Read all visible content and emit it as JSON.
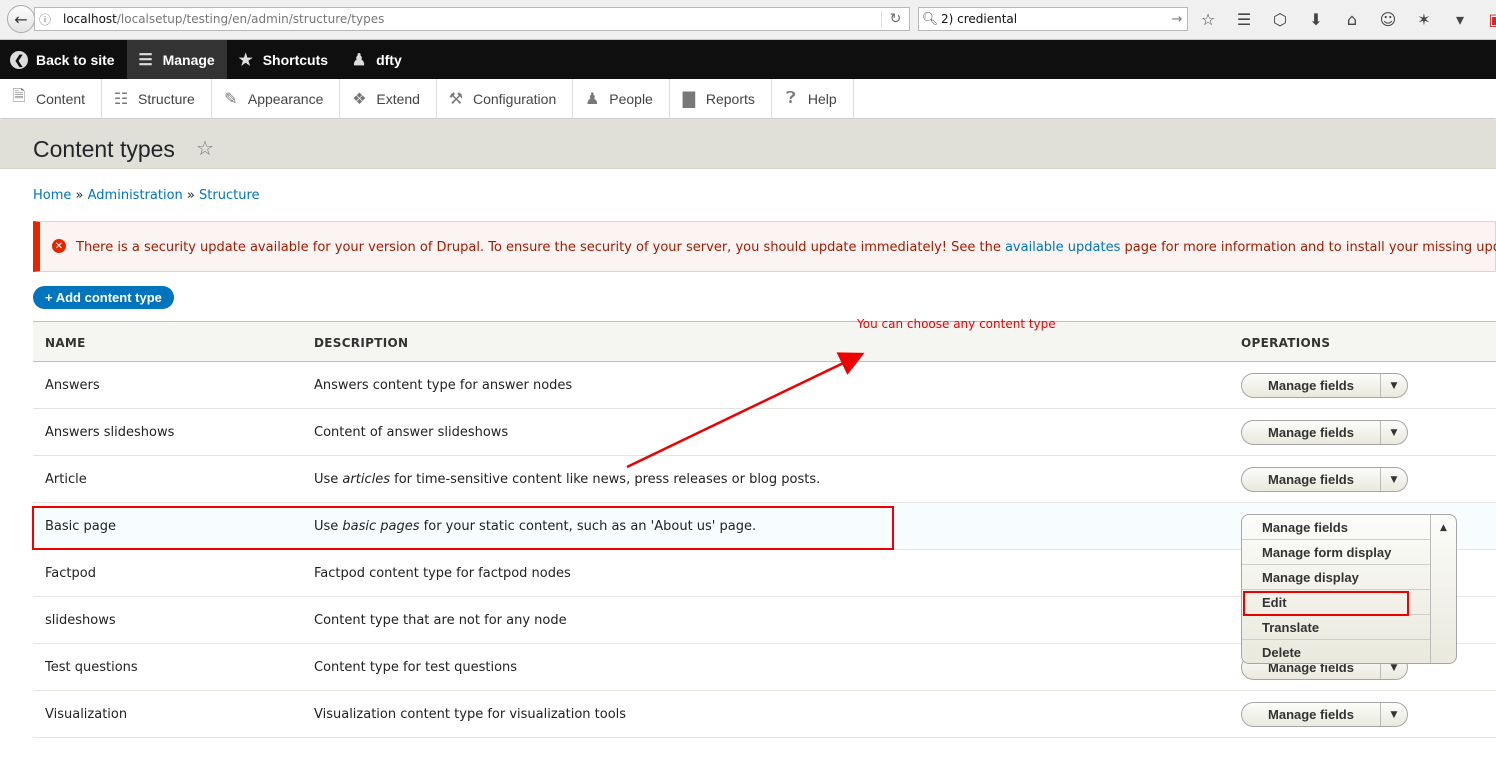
{
  "browser": {
    "url_host": "localhost",
    "url_path": "/localsetup/testing/en/admin/structure/types",
    "search_text": "2) crediental"
  },
  "toolbar": {
    "back_label": "Back to site",
    "manage_label": "Manage",
    "shortcuts_label": "Shortcuts",
    "user_label": "dfty"
  },
  "tray": {
    "items": [
      {
        "label": "Content",
        "icon": "file-icon"
      },
      {
        "label": "Structure",
        "icon": "sitemap-icon"
      },
      {
        "label": "Appearance",
        "icon": "brush-icon"
      },
      {
        "label": "Extend",
        "icon": "puzzle-icon"
      },
      {
        "label": "Configuration",
        "icon": "wrench-icon"
      },
      {
        "label": "People",
        "icon": "user-icon"
      },
      {
        "label": "Reports",
        "icon": "bar-chart-icon"
      },
      {
        "label": "Help",
        "icon": "help-icon"
      }
    ]
  },
  "page": {
    "title": "Content types"
  },
  "breadcrumb": {
    "home": "Home",
    "sep": "»",
    "admin": "Administration",
    "structure": "Structure"
  },
  "alert": {
    "text_before": "There is a security update available for your version of Drupal. To ensure the security of your server, you should update immediately! See the ",
    "link": "available updates",
    "text_after": " page for more information and to install your missing updates."
  },
  "actions": {
    "add_label": "+ Add content type"
  },
  "table": {
    "headers": {
      "name": "NAME",
      "description": "DESCRIPTION",
      "operations": "OPERATIONS"
    },
    "rows": [
      {
        "name": "Answers",
        "desc_pre": "Answers content type for answer nodes",
        "desc_em": "",
        "desc_post": "",
        "op": "Manage fields"
      },
      {
        "name": "Answers slideshows",
        "desc_pre": "Content of answer slideshows",
        "desc_em": "",
        "desc_post": "",
        "op": "Manage fields"
      },
      {
        "name": "Article",
        "desc_pre": "Use ",
        "desc_em": "articles",
        "desc_post": " for time-sensitive content like news, press releases or blog posts.",
        "op": "Manage fields"
      },
      {
        "name": "Basic page",
        "desc_pre": "Use ",
        "desc_em": "basic pages",
        "desc_post": " for your static content, such as an 'About us' page.",
        "op": "Manage fields"
      },
      {
        "name": "Factpod",
        "desc_pre": "Factpod content type for factpod nodes",
        "desc_em": "",
        "desc_post": "",
        "op": ""
      },
      {
        "name": "slideshows",
        "desc_pre": "Content type that are not for any node",
        "desc_em": "",
        "desc_post": "",
        "op": ""
      },
      {
        "name": "Test questions",
        "desc_pre": "Content type for test questions",
        "desc_em": "",
        "desc_post": "",
        "op": "Manage fields"
      },
      {
        "name": "Visualization",
        "desc_pre": "Visualization content type for visualization tools",
        "desc_em": "",
        "desc_post": "",
        "op": "Manage fields"
      }
    ]
  },
  "dropdown": {
    "items": [
      "Manage fields",
      "Manage form display",
      "Manage display",
      "Edit",
      "Translate",
      "Delete"
    ]
  },
  "annotation": {
    "text": "You can choose any content type"
  }
}
